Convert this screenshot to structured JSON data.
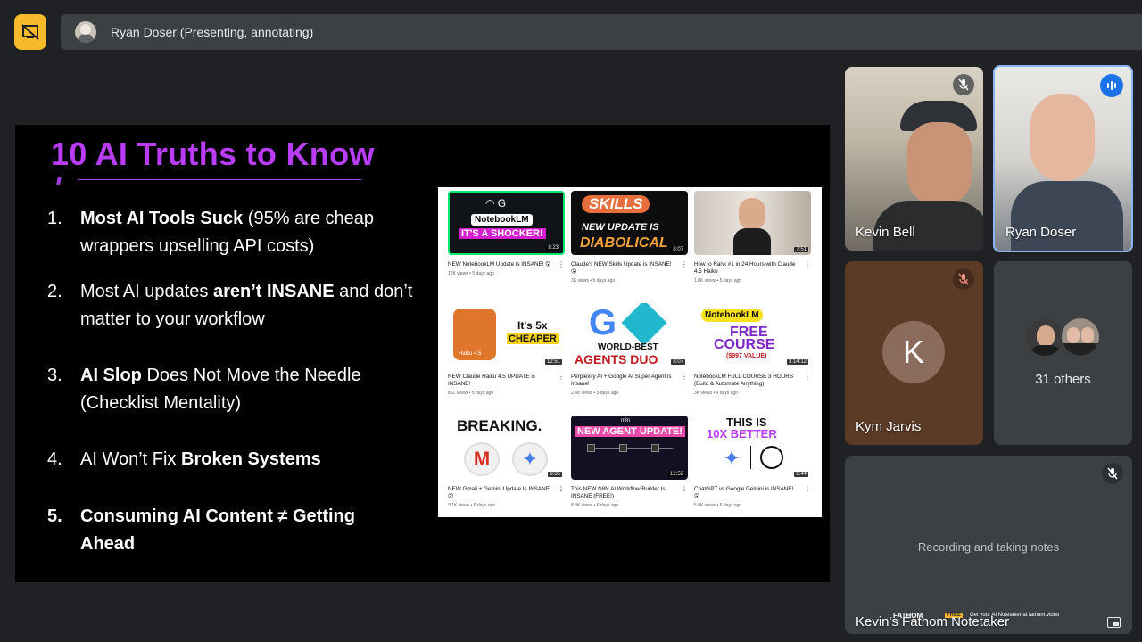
{
  "meeting": {
    "presenter_banner": "Ryan Doser (Presenting, annotating)"
  },
  "slide": {
    "title": "10 AI Truths to Know",
    "items": [
      {
        "num": "1.",
        "pre": "",
        "bold": "Most AI Tools Suck",
        "post": " (95% are cheap wrappers upselling API costs)"
      },
      {
        "num": "2.",
        "pre": "Most AI updates ",
        "bold": "aren’t INSANE",
        "post": " and don’t matter to your workflow"
      },
      {
        "num": "3.",
        "pre": "",
        "bold": "AI Slop",
        "post": " Does Not Move the Needle (Checklist Mentality)"
      },
      {
        "num": "4.",
        "pre": "AI Won’t Fix ",
        "bold": "Broken Systems",
        "post": ""
      },
      {
        "num": "5.",
        "pre": "",
        "bold": "Consuming AI Content ≠ Getting Ahead",
        "post": ""
      }
    ],
    "videos": [
      {
        "thumb_lines": [
          "NotebookLM",
          "IT'S A SHOCKER!"
        ],
        "duration": "8:23",
        "title": "NEW NotebookLM Update is INSANE! 😮",
        "meta": "12K views • 5 days ago"
      },
      {
        "thumb_lines": [
          "SKILLS",
          "NEW UPDATE IS",
          "DIABOLICAL"
        ],
        "duration": "8:07",
        "title": "Claude's NEW Skills Update is INSANE! 😮",
        "meta": "3K views • 5 days ago"
      },
      {
        "thumb_lines": [],
        "duration": "7:51",
        "title": "How to Rank #1 in 24 Hours with Claude 4.5 Haiku",
        "meta": "1.8K views • 5 days ago"
      },
      {
        "thumb_lines": [
          "Haiku 4.5",
          "It's 5x",
          "CHEAPER"
        ],
        "duration": "12:51",
        "title": "NEW Claude Haiku 4.5 UPDATE is INSANE!",
        "meta": "861 views • 5 days ago"
      },
      {
        "thumb_lines": [
          "WORLD-BEST",
          "AGENTS DUO"
        ],
        "duration": "8:07",
        "title": "Perplexity AI + Google AI Super Agent is Insane!",
        "meta": "2.4K views • 5 days ago"
      },
      {
        "thumb_lines": [
          "NotebookLM",
          "FREE",
          "COURSE",
          "($997 VALUE)"
        ],
        "duration": "3:14:12",
        "title": "NotebookLM FULL COURSE 3 HOURS (Build & Automate Anything)",
        "meta": "3K views • 6 days ago"
      },
      {
        "thumb_lines": [
          "BREAKING."
        ],
        "duration": "8:35",
        "title": "NEW Gmail + Gemini Update Is INSANE! 😮",
        "meta": "3.1K views • 6 days ago"
      },
      {
        "thumb_lines": [
          "n8n",
          "NEW AGENT UPDATE!"
        ],
        "duration": "12:52",
        "title": "This NEW N8N AI Workflow Builder Is INSANE (FREE!)",
        "meta": "8.3K views • 6 days ago"
      },
      {
        "thumb_lines": [
          "THIS IS",
          "10X BETTER"
        ],
        "duration": "8:44",
        "title": "ChatGPT vs Google Gemini is INSANE! 😮",
        "meta": "5.8K views • 6 days ago"
      }
    ]
  },
  "participants": {
    "kevin": {
      "name": "Kevin Bell"
    },
    "ryan": {
      "name": "Ryan Doser"
    },
    "kym": {
      "name": "Kym Jarvis",
      "initial": "K"
    },
    "others": {
      "label": "31 others"
    },
    "notetaker": {
      "name": "Kevin's Fathom Notetaker",
      "status": "Recording and taking notes",
      "brand": "FATHOM",
      "badge": "FREE",
      "promo": "Get your AI Notetaker at fathom.video"
    }
  }
}
